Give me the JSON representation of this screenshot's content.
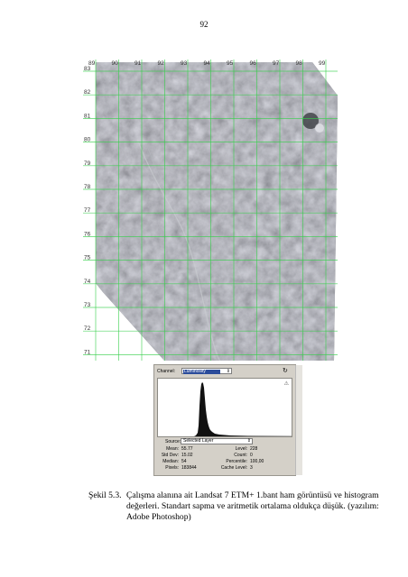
{
  "page_number": "92",
  "map": {
    "x_grid_labels": [
      "89",
      "90",
      "91",
      "92",
      "93",
      "94",
      "95",
      "96",
      "97",
      "98",
      "99"
    ],
    "y_grid_labels": [
      "83",
      "82",
      "81",
      "80",
      "79",
      "78",
      "77",
      "76",
      "75",
      "74",
      "73",
      "72",
      "71"
    ],
    "grid_color": "#35d04a"
  },
  "histogram_panel": {
    "channel_label": "Channel:",
    "channel_value": "Luminosity",
    "source_label": "Source:",
    "source_value": "Selected Layer",
    "stats_left": [
      {
        "label": "Mean:",
        "value": "55.77"
      },
      {
        "label": "Std Dev:",
        "value": "15.02"
      },
      {
        "label": "Median:",
        "value": "54"
      },
      {
        "label": "Pixels:",
        "value": "183844"
      }
    ],
    "stats_right": [
      {
        "label": "Level:",
        "value": "228"
      },
      {
        "label": "Count:",
        "value": "0"
      },
      {
        "label": "Percentile:",
        "value": "100,00"
      },
      {
        "label": "Cache Level:",
        "value": "3"
      }
    ]
  },
  "caption": {
    "label": "Şekil 5.3.",
    "lines": [
      "Çalışma alanına ait Landsat 7 ETM+ 1.bant ham görüntüsü ve histogram",
      "değerleri. Standart sapma ve aritmetik ortalama oldukça düşük. (yazılım:",
      "Adobe Photoshop)"
    ]
  }
}
